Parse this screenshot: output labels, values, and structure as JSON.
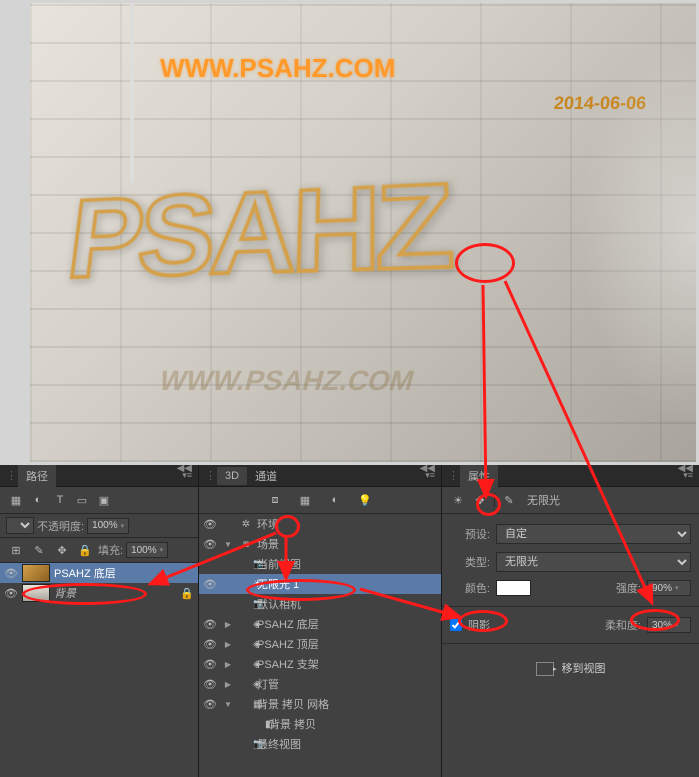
{
  "canvas": {
    "title_url": "WWW.PSAHZ.COM",
    "date": "2014-06-06",
    "main_text": "PSAHZ",
    "shadow_url": "WWW.PSAHZ.COM"
  },
  "layers_panel": {
    "tab_paths": "路径",
    "opacity_label": "不透明度:",
    "opacity_value": "100%",
    "fill_label": "填充:",
    "fill_value": "100%",
    "layer_name": "PSAHZ 底层",
    "bg_name": "背景"
  },
  "panel_3d": {
    "tab_3d": "3D",
    "tab_channels": "通道",
    "env": "环境",
    "scene": "场景",
    "current_view": "当前视图",
    "infinite_light": "无限光 1",
    "default_camera": "默认相机",
    "layA": "PSAHZ 底层",
    "layB": "PSAHZ 顶层",
    "layC": "PSAHZ 支架",
    "tube": "灯管",
    "bg_mesh": "背景 拷贝 网格",
    "bg_copy": "背景 拷贝",
    "final_view": "最终视图"
  },
  "props": {
    "tab": "属性",
    "mode_label": "无限光",
    "preset_label": "预设:",
    "preset_value": "自定",
    "type_label": "类型:",
    "type_value": "无限光",
    "color_label": "颜色:",
    "intensity_label": "强度:",
    "intensity_value": "90%",
    "shadow_label": "阴影",
    "soft_label": "柔和度:",
    "soft_value": "30%",
    "move_to_view": "移到视图"
  }
}
